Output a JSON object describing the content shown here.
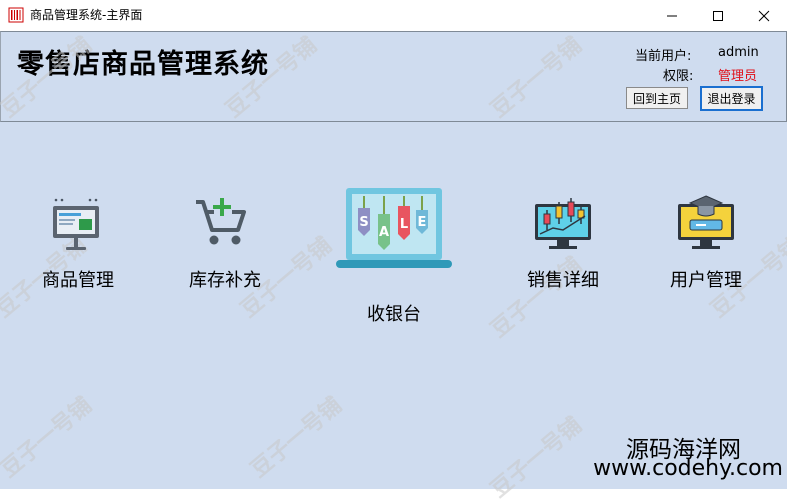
{
  "window": {
    "title": "商品管理系统-主界面",
    "minimize_icon": "minimize-icon",
    "maximize_icon": "maximize-icon",
    "close_icon": "close-icon"
  },
  "header": {
    "app_title": "零售店商品管理系统",
    "current_user_label": "当前用户:",
    "current_user_value": "admin",
    "permission_label": "权限:",
    "permission_value": "管理员",
    "permission_color": "#e0101a",
    "home_button": "回到主页",
    "logout_button": "退出登录"
  },
  "modules": [
    {
      "label": "商品管理",
      "icon": "monitor-chart-icon"
    },
    {
      "label": "库存补充",
      "icon": "cart-add-icon"
    },
    {
      "label": "收银台",
      "icon": "sale-laptop-icon"
    },
    {
      "label": "销售详细",
      "icon": "candlestick-monitor-icon"
    },
    {
      "label": "用户管理",
      "icon": "graduation-monitor-icon"
    }
  ],
  "watermark": {
    "text": "豆子一号铺",
    "site_name": "源码海洋网",
    "site_url": "www.codehy.com"
  }
}
